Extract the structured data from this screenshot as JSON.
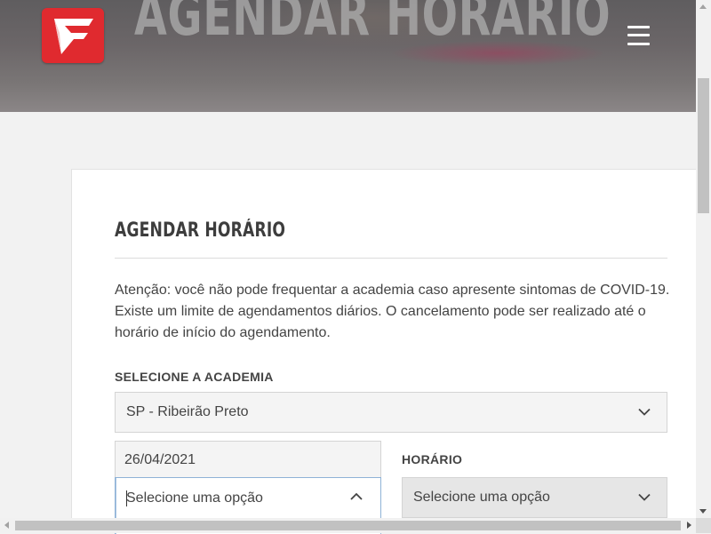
{
  "hero": {
    "title": "AGENDAR HORÁRIO",
    "logo_icon": "brand-logo-icon",
    "menu_icon": "hamburger-menu-icon",
    "brand_color": "#e02a2f"
  },
  "form": {
    "title": "AGENDAR HORÁRIO",
    "notice_lines": [
      "Atenção: você não pode frequentar a academia caso apresente sintomas de COVID-19.",
      "Existe um limite de agendamentos diários. O cancelamento pode ser realizado até o",
      "horário de início do agendamento."
    ],
    "academia": {
      "label": "SELECIONE A ACADEMIA",
      "value": "SP - Ribeirão Preto"
    },
    "date": {
      "value": "26/04/2021"
    },
    "modalidade": {
      "placeholder": "Selecione uma opção",
      "state": "open"
    },
    "horario": {
      "label": "HORÁRIO",
      "placeholder": "Selecione uma opção"
    }
  },
  "icons": {
    "chevron_down": "chevron-down-icon",
    "chevron_up": "chevron-up-icon"
  }
}
